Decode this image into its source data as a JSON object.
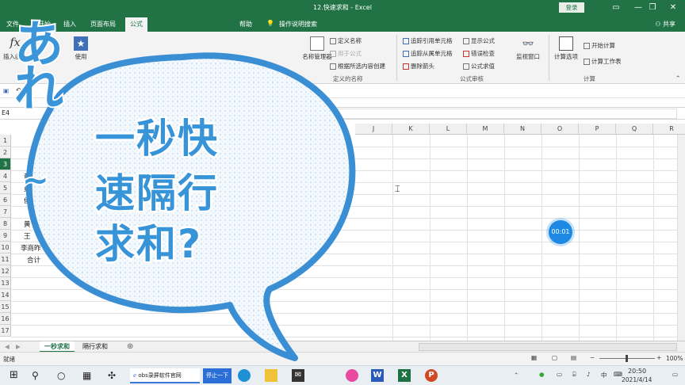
{
  "titlebar": {
    "title": "12.快速求和 - Excel",
    "login": "登录",
    "min": "—",
    "restore": "❐",
    "close": "✕"
  },
  "tabs": {
    "file": "文件",
    "home": "开始",
    "insert": "插入",
    "layout": "页面布局",
    "formulas": "公式",
    "help": "帮助",
    "tell_me": "操作说明搜索",
    "share": "共享"
  },
  "ribbon": {
    "insert_fn": "插入函数",
    "recent": "使用",
    "name_manager": "名称管理器",
    "define_name": "定义名称",
    "use_in_formula": "用于公式",
    "create_from_selection": "根据所选内容创建",
    "defined_names_label": "定义的名称",
    "trace_precedents": "追踪引用单元格",
    "trace_dependents": "追踪从属单元格",
    "remove_arrows": "删除箭头",
    "show_formulas": "显示公式",
    "error_checking": "错误检查",
    "evaluate_formula": "公式求值",
    "formula_auditing_label": "公式审核",
    "watch_window": "监视窗口",
    "calc_options": "计算选项",
    "calc_now": "开始计算",
    "calc_sheet": "计算工作表",
    "calculation_label": "计算"
  },
  "formula_bar": {
    "name_box": "E4"
  },
  "grid": {
    "columns": [
      "J",
      "K",
      "L",
      "M",
      "N",
      "O",
      "P",
      "Q",
      "R"
    ],
    "rows": [
      "1",
      "2",
      "3",
      "4",
      "5",
      "6",
      "7",
      "8",
      "9",
      "10",
      "11",
      "12",
      "13",
      "14",
      "15",
      "16",
      "17"
    ],
    "cells": {
      "r4": "黄",
      "r5": "黄",
      "r6": "侯",
      "r8": "黄",
      "r9": "王",
      "r10": "李商昨",
      "r11": "合计"
    }
  },
  "sheets": [
    {
      "label": "一秒求和"
    },
    {
      "label": "隔行求和"
    }
  ],
  "add_sheet": "⊕",
  "status": {
    "ready": "就绪",
    "zoom": "100%"
  },
  "overlay": {
    "are": "あれ",
    "tilde": "~",
    "line1": "一秒快",
    "line2": "速隔行",
    "line3": "求和?",
    "timer": "00:01"
  },
  "taskbar": {
    "browser_label": "obs录屏软件官网",
    "ime_label": "停止一下",
    "time": "20:50",
    "date": "2021/4/14"
  }
}
